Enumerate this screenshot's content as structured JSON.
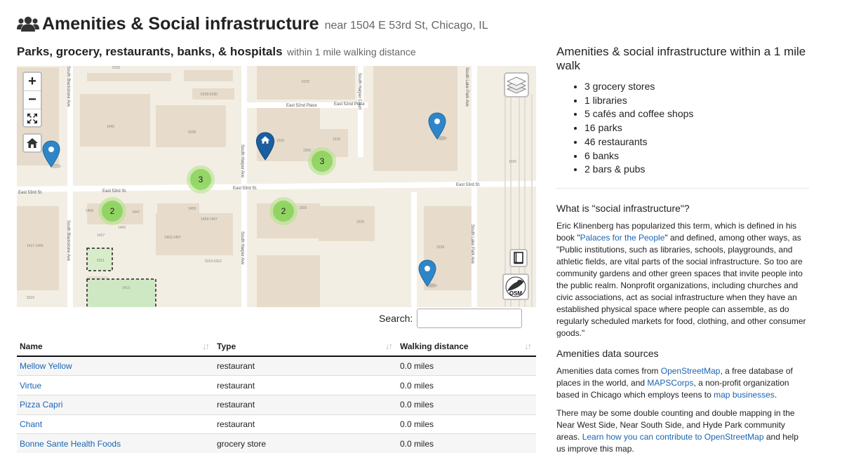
{
  "page": {
    "title": "Amenities & Social infrastructure",
    "address": "near 1504 E 53rd St, Chicago, IL"
  },
  "map_section": {
    "heading": "Parks, grocery, restaurants, banks, & hospitals",
    "subheading": "within 1 mile walking distance",
    "controls": {
      "zoom_in": "+",
      "zoom_out": "−"
    },
    "streets": [
      "East 53rd St.",
      "East 53rd St.",
      "East 53rd St.",
      "East 53rd St.",
      "East 52nd Place",
      "East 52nd Place",
      "South Blackstone Ave",
      "South Harper Ave",
      "South Harper Court",
      "South Lake Park Ave",
      "South Blackstone Ave",
      "South Harper Ave",
      "South Lake Park Ave"
    ],
    "building_numbers": [
      "5225",
      "5225",
      "5228-5230",
      "1440",
      "5238",
      "1526",
      "1506",
      "1516",
      "1555",
      "1459",
      "1447",
      "1459",
      "1459-1467",
      "1443",
      "1437",
      "1453-1457",
      "1525",
      "1509",
      "1417-1425",
      "5311",
      "5310-5312",
      "1539",
      "5316",
      "1413"
    ],
    "clusters": [
      {
        "count": "3"
      },
      {
        "count": "3"
      },
      {
        "count": "2"
      },
      {
        "count": "2"
      }
    ],
    "osm_label": "OSM"
  },
  "table": {
    "search_label": "Search:",
    "search_value": "",
    "columns": [
      "Name",
      "Type",
      "Walking distance"
    ],
    "rows": [
      {
        "name": "Mellow Yellow",
        "type": "restaurant",
        "distance": "0.0 miles"
      },
      {
        "name": "Virtue",
        "type": "restaurant",
        "distance": "0.0 miles"
      },
      {
        "name": "Pizza Capri",
        "type": "restaurant",
        "distance": "0.0 miles"
      },
      {
        "name": "Chant",
        "type": "restaurant",
        "distance": "0.0 miles"
      },
      {
        "name": "Bonne Sante Health Foods",
        "type": "grocery store",
        "distance": "0.0 miles"
      }
    ]
  },
  "sidebar": {
    "heading": "Amenities & social infrastructure within a 1 mile walk",
    "counts": [
      "3 grocery stores",
      "1 libraries",
      "5 cafés and coffee shops",
      "16 parks",
      "46 restaurants",
      "6 banks",
      "2 bars & pubs"
    ],
    "what_heading": "What is \"social infrastructure\"?",
    "what_p_1": "Eric Klinenberg has popularized this term, which is defined in his book \"",
    "what_link": "Palaces for the People",
    "what_p_2": "\" and defined, among other ways, as \"Public institutions, such as libraries, schools, playgrounds, and athletic fields, are vital parts of the social infrastructure. So too are community gardens and other green spaces that invite people into the public realm. Nonprofit organizations, including churches and civic associations, act as social infrastructure when they have an established physical space where people can assemble, as do regularly scheduled markets for food, clothing, and other consumer goods.\"",
    "sources_heading": "Amenities data sources",
    "src_p_1": "Amenities data comes from ",
    "src_link_osm": "OpenStreetMap",
    "src_p_2": ", a free database of places in the world, and ",
    "src_link_maps": "MAPSCorps",
    "src_p_3": ", a non-profit organization based in Chicago which employs teens to ",
    "src_link_map": "map businesses",
    "src_p_4": ".",
    "dc_p_1": "There may be some double counting and double mapping in the Near West Side, Near South Side, and Hyde Park community areas. ",
    "dc_link": "Learn how you can contribute to OpenStreetMap",
    "dc_p_2": " and help us improve this map."
  },
  "colors": {
    "link": "#1a64b4",
    "pin": "#2e86c8",
    "home_pin": "#1b5fa0",
    "cluster_inner": "#6ecc39",
    "cluster_outer": "#b5e28c",
    "park": "#cfe8c4"
  }
}
